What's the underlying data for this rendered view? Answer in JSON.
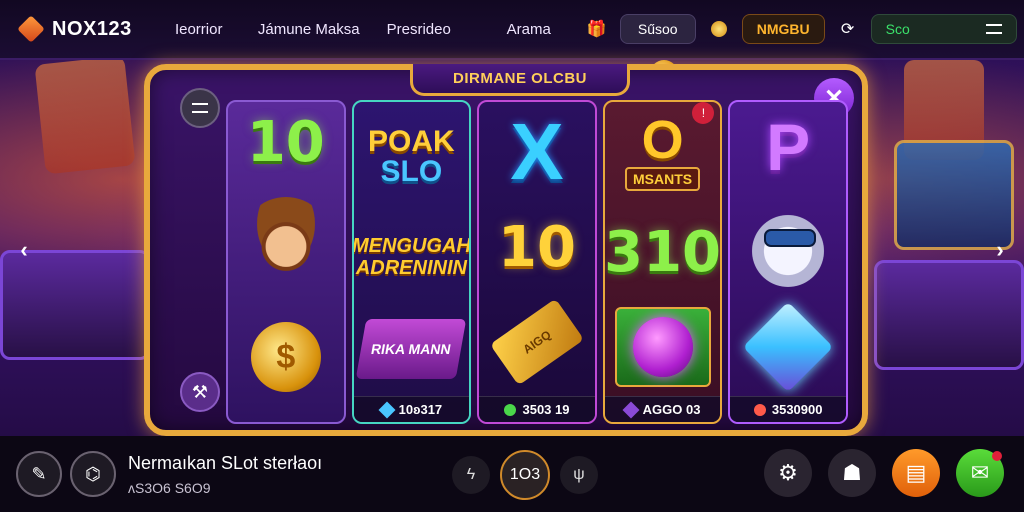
{
  "brand": {
    "name": "NOX123"
  },
  "nav": {
    "items": [
      "Ieorrior",
      "Jámune Maksa",
      "Presrideo",
      "Arama"
    ]
  },
  "header": {
    "search_label": "Sűsoo",
    "coin_label": "NMGBU",
    "balance_label": "Sco"
  },
  "game": {
    "title": "DIRMANE OLCBU",
    "reels": [
      {
        "top": "10",
        "footer": ""
      },
      {
        "top_a": "POAK",
        "top_b": "SLO",
        "middle": "MENGUGAH ADRENININ",
        "bottom": "RIKA MANN",
        "footer": "10ʚ317"
      },
      {
        "middle": "10",
        "bottom": "AIGQ",
        "footer": "3503 19"
      },
      {
        "top": "MSANTS",
        "middle": "310",
        "footer": "AGGO 03"
      },
      {
        "footer": "3530900"
      }
    ]
  },
  "footer": {
    "title": "Nermaıkan SLot sterłaoı",
    "subtitle": "ʌS3O6 S6O9",
    "bet_value": "1O3"
  },
  "icons": {
    "close": "close-icon",
    "menu": "hamburger-icon",
    "settings": "gear-icon",
    "chat": "chat-icon"
  },
  "colors": {
    "frame": "#e8a93c",
    "accent_purple": "#b45cff",
    "balance_green": "#3be06a",
    "coin_gold": "#ffb52e"
  }
}
